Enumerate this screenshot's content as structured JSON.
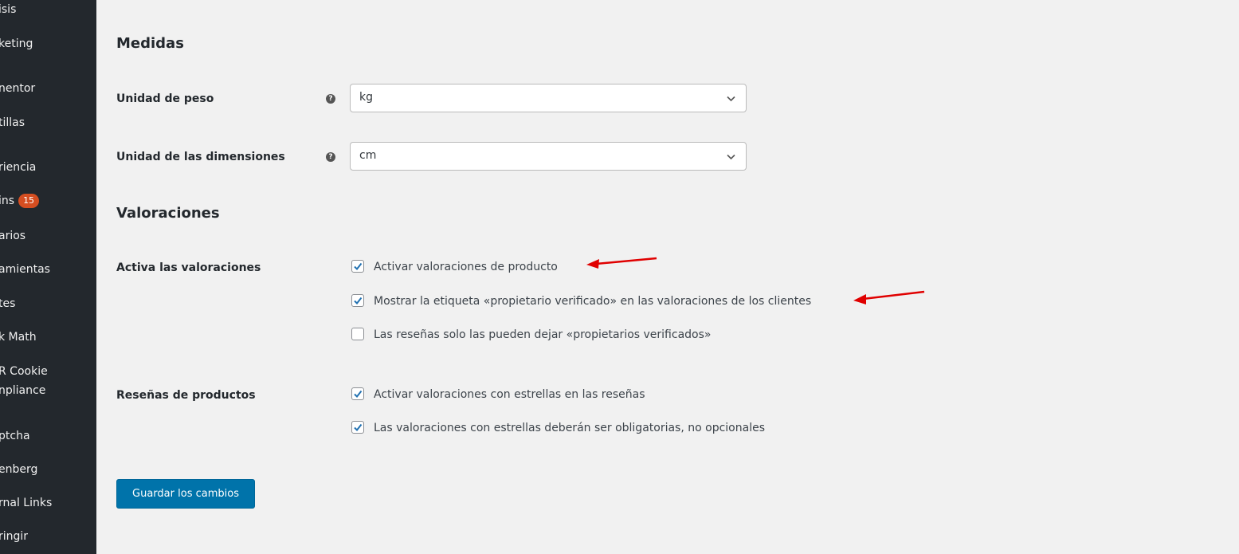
{
  "sidebar": {
    "items": [
      {
        "label": "isis"
      },
      {
        "label": "keting"
      },
      {
        "label": "nentor"
      },
      {
        "label": "tillas"
      },
      {
        "label": "riencia"
      },
      {
        "label": "ins",
        "badge": "15"
      },
      {
        "label": "arios"
      },
      {
        "label": "amientas"
      },
      {
        "label": "tes"
      },
      {
        "label": "k Math"
      },
      {
        "label": "R Cookie"
      },
      {
        "label": "npliance"
      },
      {
        "label": "ptcha"
      },
      {
        "label": "enberg"
      },
      {
        "label": "rnal Links"
      },
      {
        "label": "ringir"
      }
    ]
  },
  "measures": {
    "heading": "Medidas",
    "weight_label": "Unidad de peso",
    "weight_value": "kg",
    "dimension_label": "Unidad de las dimensiones",
    "dimension_value": "cm"
  },
  "ratings": {
    "heading": "Valoraciones",
    "enable_label": "Activa las valoraciones",
    "options": [
      {
        "label": "Activar valoraciones de producto",
        "checked": true
      },
      {
        "label": "Mostrar la etiqueta «propietario verificado» en las valoraciones de los clientes",
        "checked": true
      },
      {
        "label": "Las reseñas solo las pueden dejar «propietarios verificados»",
        "checked": false
      }
    ],
    "reviews_label": "Reseñas de productos",
    "review_options": [
      {
        "label": "Activar valoraciones con estrellas en las reseñas",
        "checked": true
      },
      {
        "label": "Las valoraciones con estrellas deberán ser obligatorias, no opcionales",
        "checked": true
      }
    ]
  },
  "save_button": "Guardar los cambios",
  "colors": {
    "sidebar_bg": "#23282d",
    "page_bg": "#f1f1f1",
    "primary_button": "#0073aa",
    "badge": "#d54e21",
    "annotation_arrow": "#e00000",
    "checkmark": "#2271b1"
  },
  "icons": {
    "help": "question-circle-icon",
    "select_arrow": "chevron-down-icon",
    "check": "checkmark-icon"
  }
}
